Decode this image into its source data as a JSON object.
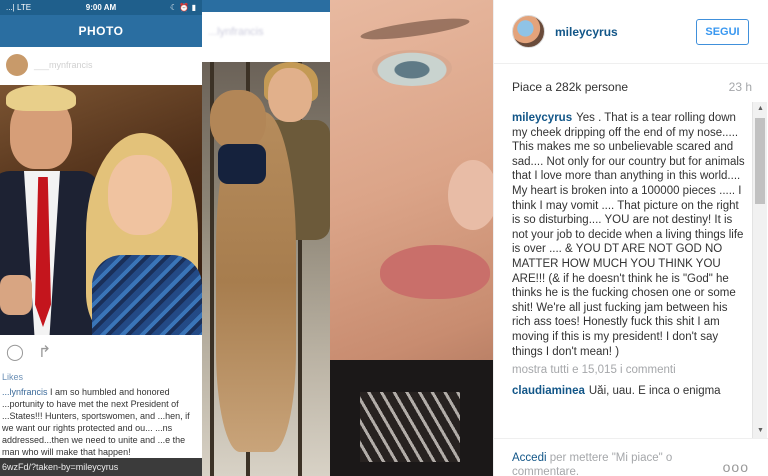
{
  "screenshot1": {
    "carrier": "...| LTE",
    "time": "9:00 AM",
    "battery": "☾ ⏰ ▮",
    "nav_title": "PHOTO",
    "username_blurred": "___mynfrancis",
    "likes": "Likes",
    "caption_user": "...lynfrancis",
    "caption": "I am so humbled and honored ...portunity to have met the next President of ...States!!! Hunters, sportswomen, and ...hen, if we want our rights protected and ou... ...ns addressed...then we need to unite and ...e the man who will make that happen!",
    "url": "6wzFd/?taken-by=mileycyrus"
  },
  "screenshot2": {
    "username_blurred": "...lynfrancis"
  },
  "post": {
    "username": "mileycyrus",
    "follow_label": "SEGUI",
    "likes": "Piace a 282k persone",
    "time_ago": "23 h",
    "caption_user": "mileycyrus",
    "caption": "Yes . That is a tear rolling down my cheek dripping off the end of my nose..... This makes me so unbelievable scared and sad.... Not only for our country but for animals that I love more than anything in this world.... My heart is broken into a 100000 pieces ..... I think I may vomit .... That picture on the right is so disturbing.... YOU are not destiny! It is not your job to decide when a living things life is over .... & YOU DT ARE NOT GOD NO MATTER HOW MUCH YOU THINK YOU ARE!!! (& if he doesn't think he is \"God\" he thinks he is the fucking chosen one or some shit! We're all just fucking jam between his rich ass toes! Honestly fuck this shit I am moving if this is my president! I don't say things I don't mean! )",
    "more_comments": "mostra tutti e 15,015 i commenti",
    "comment2_user": "claudiaminea",
    "comment2_text": "Uăi, uau. E inca o enigma",
    "login_link": "Accedi",
    "login_rest": " per mettere \"Mi piace\" o commentare.",
    "more_icon": "ooo",
    "scroll_up": "▲",
    "scroll_down": "▼"
  }
}
